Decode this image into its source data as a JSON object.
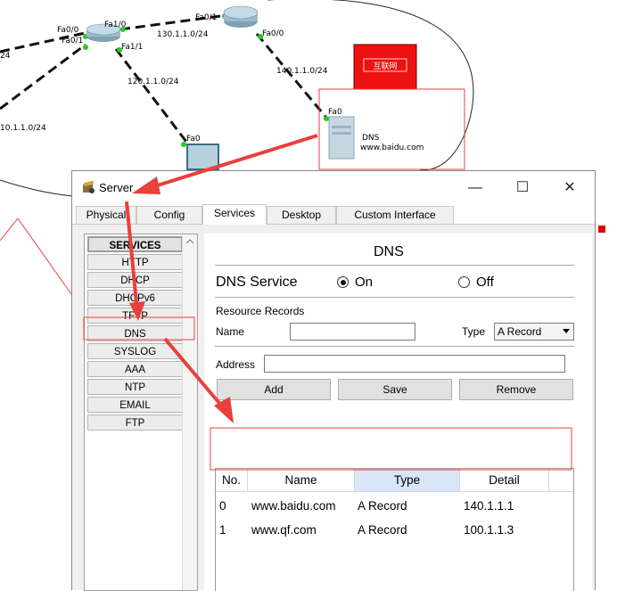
{
  "topology": {
    "links": [
      {
        "label": "Fa0/0"
      },
      {
        "label": "Fa0/1"
      },
      {
        "label": "Fa1/0"
      },
      {
        "label": "Fa1/1"
      },
      {
        "label": "Fa0/1"
      },
      {
        "label": "Fa0/0"
      },
      {
        "label": "Fa0"
      },
      {
        "label": "Fa0"
      }
    ],
    "left_label": "24",
    "net_130": "130.1.1.0/24",
    "net_120": "120.1.1.0/24",
    "net_140": "140.1.1.0/24",
    "net_10": "10.1.1.0/24",
    "internet_label": "互联网",
    "dns_label": "DNS",
    "dns_host": "www.baidu.com",
    "colors": {
      "annotation_red": "#e8403a",
      "internet_box": "#ee1111"
    }
  },
  "window": {
    "title": "Server",
    "controls": {
      "minimize": "—",
      "maximize": "☐",
      "close": "✕"
    },
    "tabs": [
      "Physical",
      "Config",
      "Services",
      "Desktop",
      "Custom Interface"
    ],
    "active_tab": "Services"
  },
  "services": {
    "header": "SERVICES",
    "items": [
      "HTTP",
      "DHCP",
      "DHCPv6",
      "TFTP",
      "DNS",
      "SYSLOG",
      "AAA",
      "NTP",
      "EMAIL",
      "FTP"
    ]
  },
  "dns": {
    "title": "DNS",
    "service_label": "DNS Service",
    "on_label": "On",
    "off_label": "Off",
    "service_state": "On",
    "rr_label": "Resource Records",
    "name_label": "Name",
    "name_value": "",
    "type_label": "Type",
    "type_value": "A Record",
    "address_label": "Address",
    "address_value": "",
    "add_label": "Add",
    "save_label": "Save",
    "remove_label": "Remove",
    "columns": [
      "No.",
      "Name",
      "Type",
      "Detail"
    ],
    "records": [
      {
        "no": "0",
        "name": "www.baidu.com",
        "type": "A Record",
        "detail": "140.1.1.1"
      },
      {
        "no": "1",
        "name": "www.qf.com",
        "type": "A Record",
        "detail": "100.1.1.3"
      }
    ]
  }
}
